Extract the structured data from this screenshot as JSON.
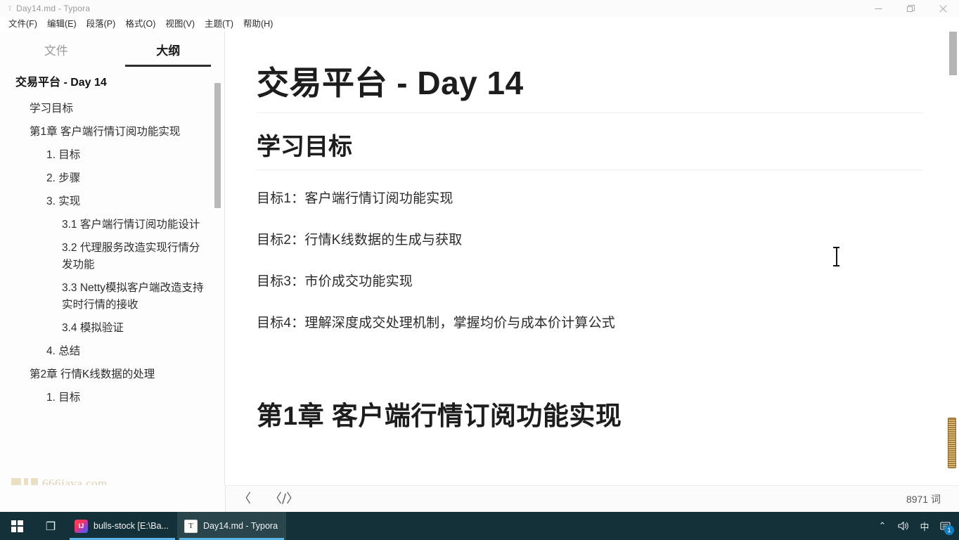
{
  "window": {
    "app_icon": "typora-document-icon",
    "title": "Day14.md - Typora",
    "controls": {
      "minimize": "minimize-icon",
      "restore": "restore-icon",
      "close": "close-icon"
    }
  },
  "menubar": {
    "items": [
      {
        "label": "文件(F)"
      },
      {
        "label": "编辑(E)"
      },
      {
        "label": "段落(P)"
      },
      {
        "label": "格式(O)"
      },
      {
        "label": "视图(V)"
      },
      {
        "label": "主题(T)"
      },
      {
        "label": "帮助(H)"
      }
    ]
  },
  "sidebar": {
    "tabs": [
      {
        "label": "文件",
        "active": false
      },
      {
        "label": "大纲",
        "active": true
      }
    ],
    "outline": [
      {
        "label": "交易平台 - Day 14",
        "level": 1
      },
      {
        "label": "学习目标",
        "level": 2
      },
      {
        "label": "第1章 客户端行情订阅功能实现",
        "level": 2
      },
      {
        "label": "1. 目标",
        "level": 3
      },
      {
        "label": "2. 步骤",
        "level": 3
      },
      {
        "label": "3. 实现",
        "level": 3
      },
      {
        "label": "3.1 客户端行情订阅功能设计",
        "level": 4
      },
      {
        "label": "3.2 代理服务改造实现行情分发功能",
        "level": 4
      },
      {
        "label": "3.3 Netty模拟客户端改造支持实时行情的接收",
        "level": 4
      },
      {
        "label": "3.4 模拟验证",
        "level": 4
      },
      {
        "label": "4. 总结",
        "level": 3
      },
      {
        "label": "第2章 行情K线数据的处理",
        "level": 2
      },
      {
        "label": "1. 目标",
        "level": 3
      }
    ],
    "watermark": "666java.com"
  },
  "document": {
    "title": "交易平台 - Day 14",
    "section_heading": "学习目标",
    "goals": [
      "目标1：客户端行情订阅功能实现",
      "目标2：行情K线数据的生成与获取",
      "目标3：市价成交功能实现",
      "目标4：理解深度成交处理机制，掌握均价与成本价计算公式"
    ],
    "chapter_heading": "第1章 客户端行情订阅功能实现"
  },
  "statusbar": {
    "back_icon": "chevron-left-icon",
    "source_icon": "source-code-icon",
    "source_glyph": "〈/〉",
    "back_glyph": "〈",
    "word_count": "8971 词"
  },
  "taskbar": {
    "start_icon": "windows-start-icon",
    "taskview_icon": "task-view-icon",
    "taskview_glyph": "❐",
    "apps": [
      {
        "label": "bulls-stock [E:\\Ba...",
        "icon": "intellij-idea-icon",
        "icon_glyph": "IJ",
        "active": false
      },
      {
        "label": "Day14.md - Typora",
        "icon": "typora-icon",
        "icon_glyph": "T",
        "active": true
      }
    ],
    "tray": [
      {
        "name": "show-hidden-icons",
        "glyph": "⌃"
      },
      {
        "name": "volume-icon",
        "glyph": "🔊"
      },
      {
        "name": "ime-language-icon",
        "glyph": "中"
      },
      {
        "name": "notifications-icon",
        "glyph": "▤",
        "badge": "1"
      }
    ]
  },
  "colors": {
    "taskbar_bg": "#143038",
    "accent": "#5ab4e6",
    "scroll_thumb": "#b4b4b4",
    "scroll_thumb_amber": "#b78b3c",
    "tab_underline": "#2f2f2f"
  }
}
